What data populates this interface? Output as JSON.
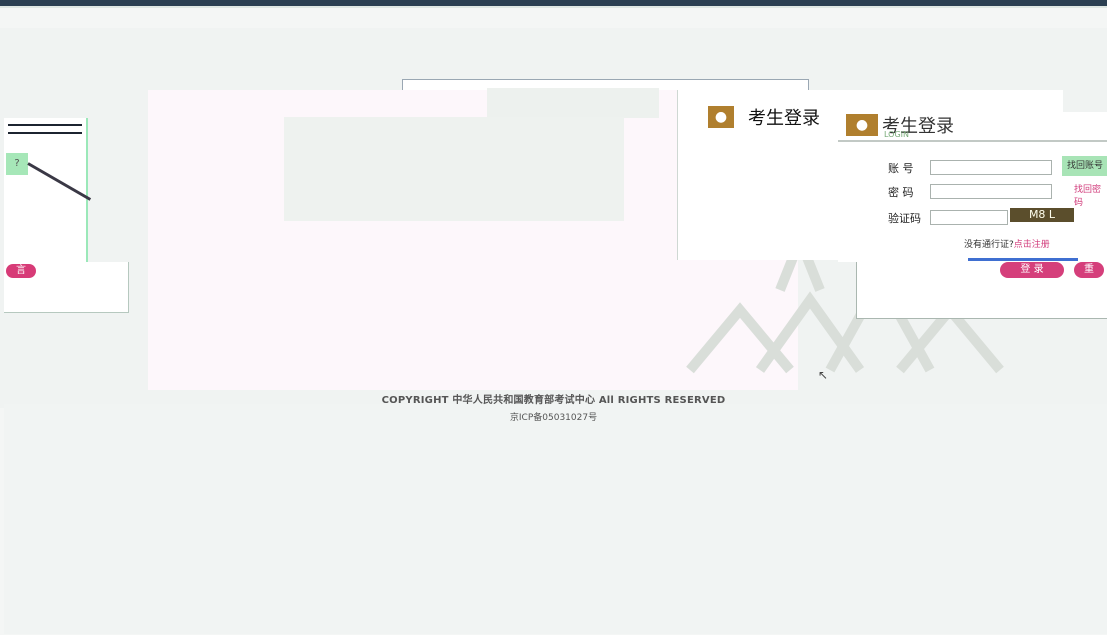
{
  "colors": {
    "accent_pink": "#d53f7b",
    "accent_green": "#a6e7b8",
    "header": "#2b3f52",
    "brand_brown": "#b07f2e"
  },
  "left_panel": {
    "question_label": "?",
    "pill_label": "言"
  },
  "login_panel_1": {
    "icon": "user-icon",
    "title": "考生登录"
  },
  "login_panel_2": {
    "icon": "user-icon",
    "title": "考生登录",
    "subtitle": "LOGIN",
    "account_label": "账 号",
    "password_label": "密 码",
    "captcha_label": "验证码",
    "captcha_value": "M8 L",
    "find_account_button": "找回账号",
    "find_password_link": "找回密码",
    "register_prompt": "没有通行证?",
    "register_link": "点击注册"
  },
  "buttons": {
    "login": "登 录",
    "reset": "重"
  },
  "footer": {
    "copyright": "COPYRIGHT 中华人民共和国教育部考试中心 All RIGHTS RESERVED",
    "icp": "京ICP备05031027号"
  }
}
